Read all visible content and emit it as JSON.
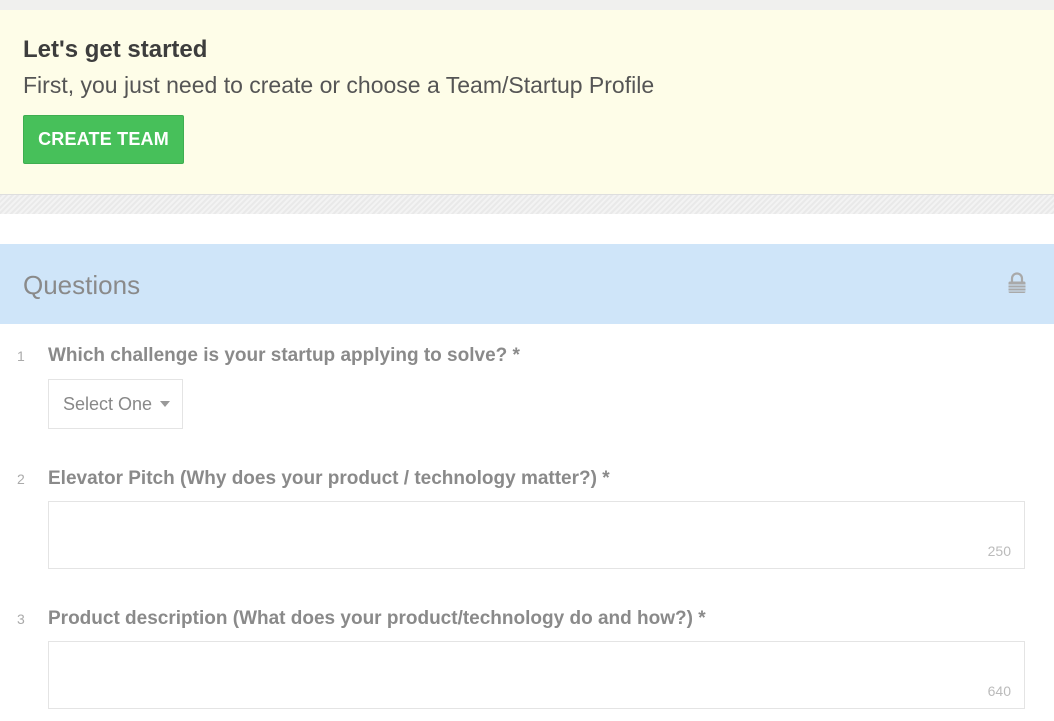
{
  "banner": {
    "title": "Let's get started",
    "subtitle": "First, you just need to create or choose a Team/Startup Profile",
    "create_button": "CREATE TEAM"
  },
  "questions": {
    "header": "Questions",
    "lock_icon": "lock-icon",
    "items": [
      {
        "number": "1",
        "label": "Which challenge is your startup applying to solve? *",
        "type": "select",
        "select_value": "Select One"
      },
      {
        "number": "2",
        "label": "Elevator Pitch (Why does your product / technology matter?) *",
        "type": "textarea",
        "value": "",
        "counter": "250"
      },
      {
        "number": "3",
        "label": "Product description (What does your product/technology do and how?) *",
        "type": "textarea",
        "value": "",
        "counter": "640"
      }
    ]
  },
  "colors": {
    "banner_bg": "#fefde8",
    "create_button": "#47c05a",
    "questions_header_bg": "#cfe5f9"
  }
}
